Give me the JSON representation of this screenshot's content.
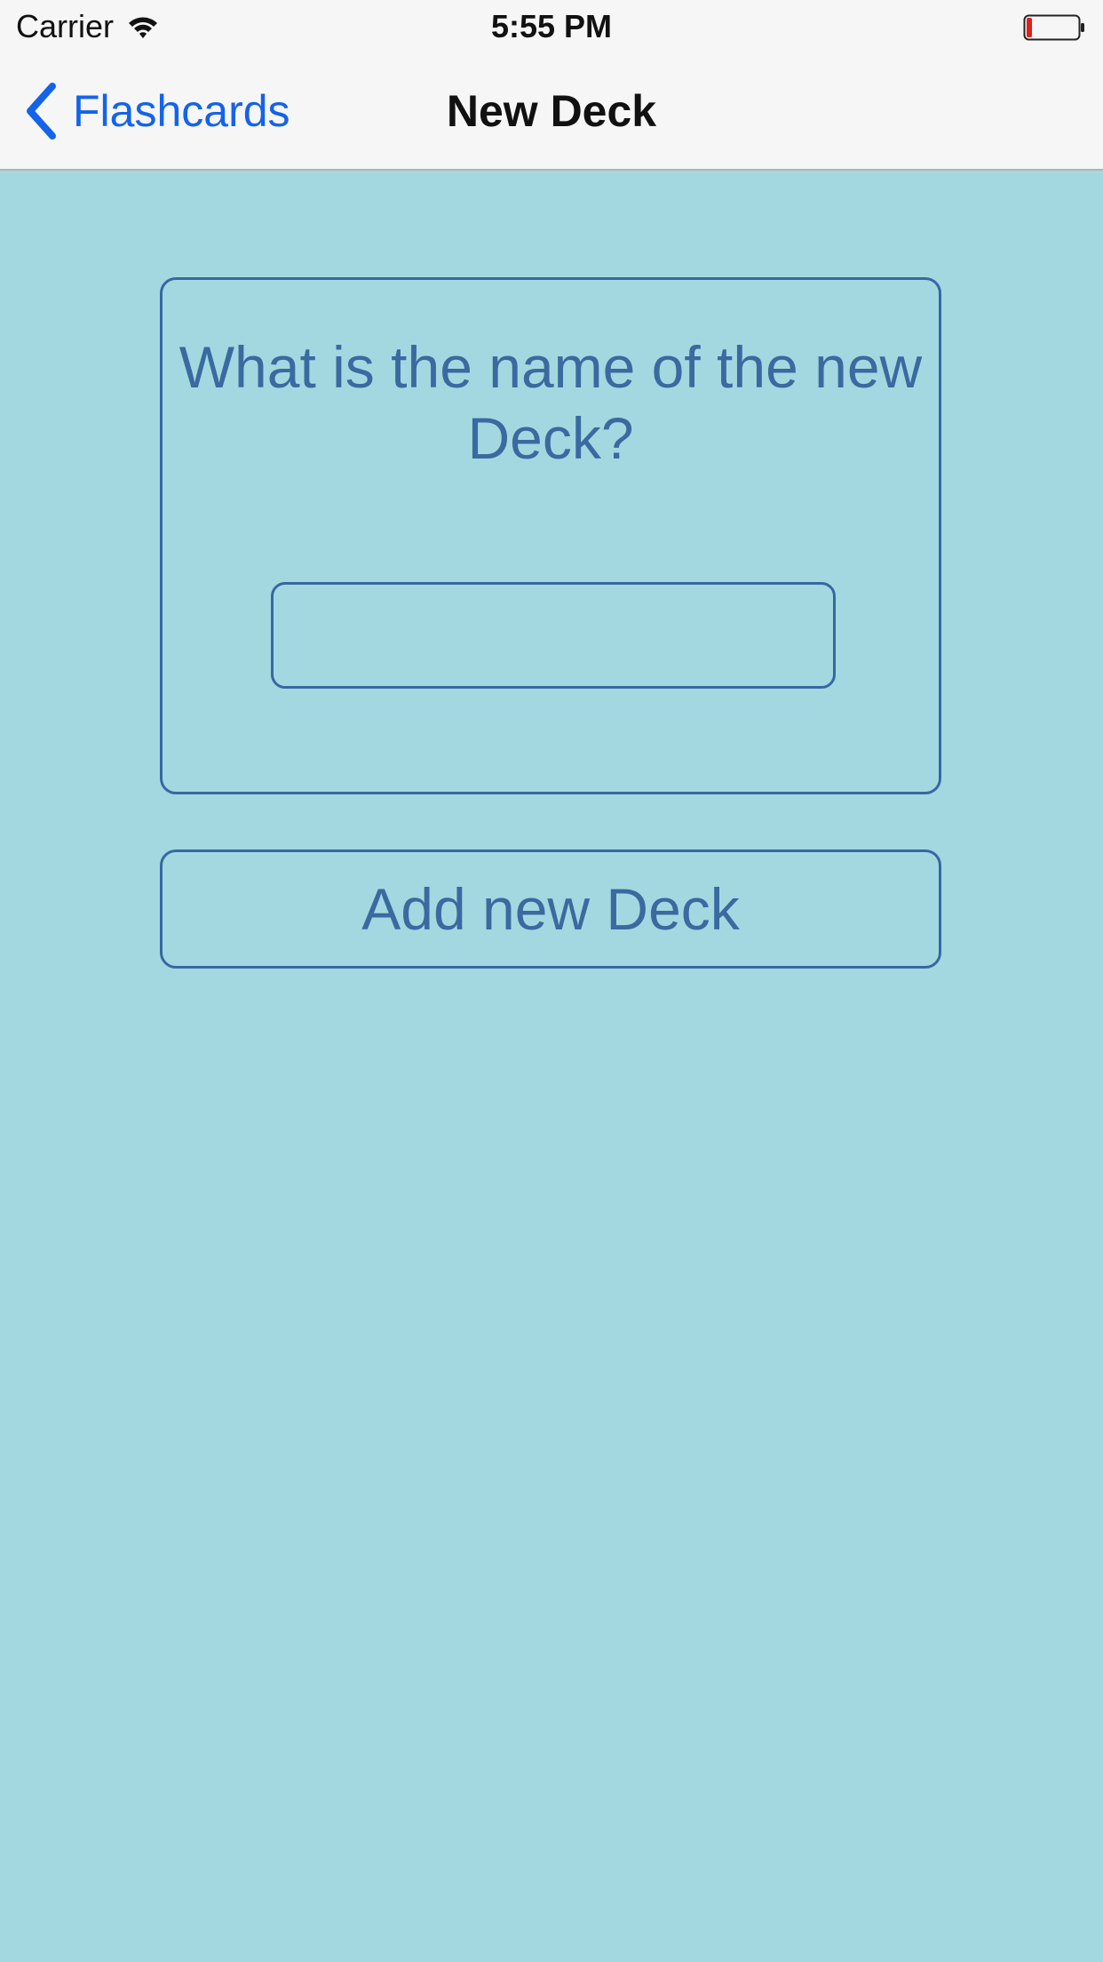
{
  "status_bar": {
    "carrier": "Carrier",
    "time": "5:55 PM",
    "battery_color": "#e0201b",
    "icons": [
      "wifi-icon",
      "battery-icon"
    ]
  },
  "nav": {
    "back_label": "Flashcards",
    "back_icon": "chevron-left-icon",
    "title": "New Deck",
    "accent_color": "#1463e8"
  },
  "form": {
    "question": "What is the name of the new Deck?",
    "deck_name_value": "",
    "deck_name_placeholder": ""
  },
  "actions": {
    "add_label": "Add new Deck"
  },
  "theme": {
    "background": "#a3d8e0",
    "border_color": "#3768a2",
    "text_color": "#3a6aa0"
  }
}
